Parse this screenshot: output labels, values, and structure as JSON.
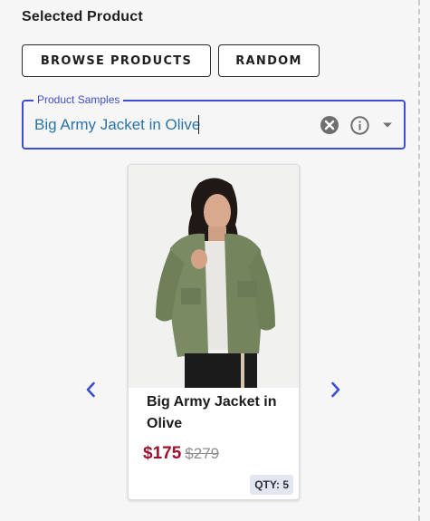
{
  "section": {
    "title": "Selected Product"
  },
  "actions": {
    "browse_label": "Browse Products",
    "random_label": "Random"
  },
  "product_field": {
    "label": "Product Samples",
    "value": "Big Army Jacket in Olive"
  },
  "icons": {
    "clear": "clear-circle-icon",
    "info": "info-circle-icon",
    "dropdown": "caret-down-icon",
    "prev": "chevron-left-icon",
    "next": "chevron-right-icon"
  },
  "colors": {
    "accent": "#3d4fd0",
    "input_text": "#2b74a8",
    "sale_price": "#a0102d",
    "jacket": "#7a8a63"
  },
  "product": {
    "title": "Big Army Jacket in Olive",
    "sale_price": "$175",
    "original_price": "$279",
    "qty_label": "QTY: 5"
  }
}
